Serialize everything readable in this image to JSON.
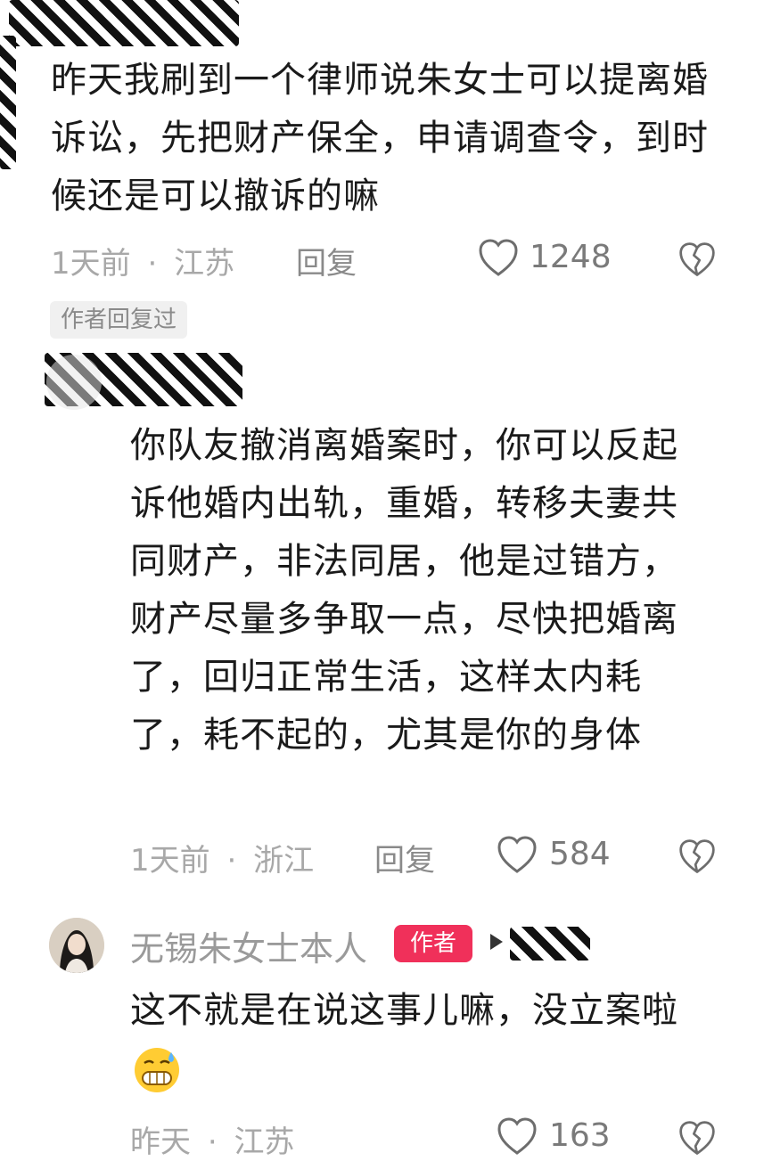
{
  "comments": [
    {
      "text": "昨天我刷到一个律师说朱女士可以提离婚诉讼，先把财产保全，申请调查令，到时候还是可以撤诉的嘛",
      "time": "1天前",
      "location": "江苏",
      "reply_label": "回复",
      "likes": "1248",
      "author_replied_tag": "作者回复过"
    },
    {
      "text": "你队友撤消离婚案时，你可以反起诉他婚内出轨，重婚，转移夫妻共同财产，非法同居，他是过错方，财产尽量多争取一点，尽快把婚离了，回归正常生活，这样太内耗了，耗不起的，尤其是你的身体",
      "time": "1天前",
      "location": "浙江",
      "reply_label": "回复",
      "likes": "584"
    },
    {
      "username": "无锡朱女士本人",
      "author_badge": "作者",
      "text": "这不就是在说这事儿嘛，没立案啦",
      "time": "昨天",
      "location": "江苏",
      "likes": "163"
    }
  ],
  "separator": "·",
  "icons": [
    "heart-icon",
    "broken-heart-icon",
    "cool-emoji-icon"
  ],
  "colors": {
    "author_badge": "#f0305a",
    "meta_text": "#a8a8a8"
  }
}
